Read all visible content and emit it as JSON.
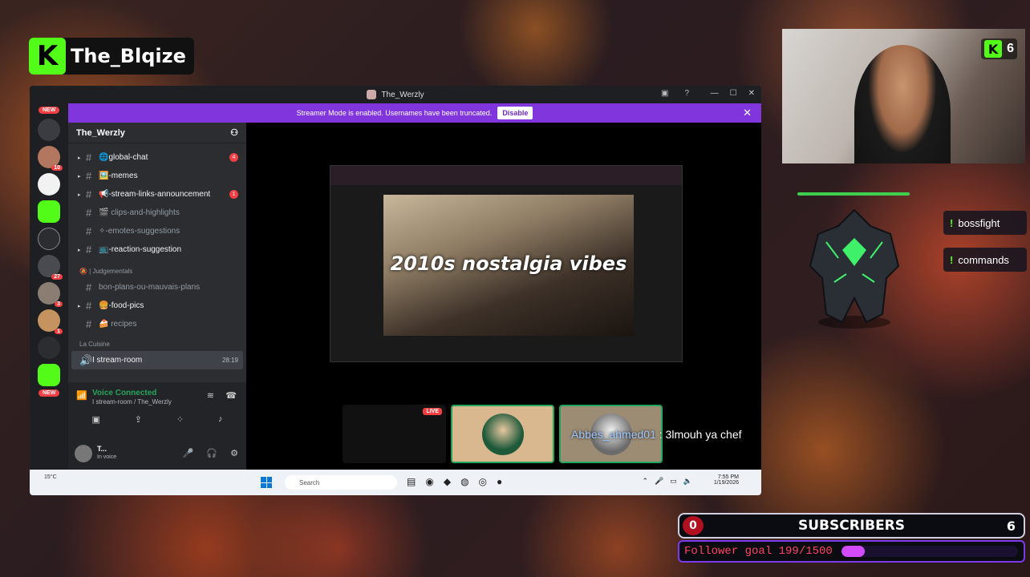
{
  "streamer": {
    "name": "The_Blqize",
    "viewer_count": "6"
  },
  "discord": {
    "window_title": "The_Werzly",
    "banner": {
      "text": "Streamer Mode is enabled. Usernames have been truncated.",
      "button": "Disable"
    },
    "new_label": "NEW",
    "guild_name": "The_Werzly",
    "server_badges": [
      "10",
      "27",
      "3",
      "1"
    ],
    "channels": [
      {
        "label": "🌐global-chat",
        "count": "4",
        "muted": false
      },
      {
        "label": "🖼️-memes",
        "count": "",
        "muted": false
      },
      {
        "label": "📢-stream-links-announcement",
        "count": "1",
        "muted": false
      },
      {
        "label": "🎬 clips-and-highlights",
        "count": "",
        "muted": true
      },
      {
        "label": "✧-emotes-suggestions",
        "count": "",
        "muted": true
      },
      {
        "label": "📺-reaction-suggestion",
        "count": "",
        "muted": false
      }
    ],
    "category_judgementals": "🔕 | Judgementals",
    "channels2": [
      {
        "label": "bon-plans-ou-mauvais-plans",
        "muted": true
      },
      {
        "label": "🍔-food-pics",
        "muted": false
      },
      {
        "label": "🍰 recipes",
        "muted": true
      }
    ],
    "category_cuisine": "La Cuisine",
    "active_voice": {
      "label": "I stream-room",
      "time": "28:19"
    },
    "voice_status": "Voice Connected",
    "voice_room": "I stream-room / The_Werzly",
    "user": {
      "name": "T...",
      "status": "In voice"
    },
    "stream_overlay": "2010s nostalgia vibes",
    "live_label": "LIVE",
    "chat": {
      "user": "Abbes_ahmed01",
      "message": " : 3lmouh ya chef"
    }
  },
  "taskbar": {
    "weather_temp": "15°C",
    "search_placeholder": "Search",
    "time": "7:55 PM",
    "date": "1/19/2026"
  },
  "commands": [
    "bossfight",
    "commands"
  ],
  "subscribers": {
    "label": "SUBSCRIBERS",
    "current": "0",
    "goal": "6"
  },
  "follower_goal": {
    "text": "Follower goal 199/1500",
    "fraction": 0.1327
  },
  "colors": {
    "kick_green": "#53fc18",
    "discord_purple": "#8035dd",
    "goal_fill": "#d24cff"
  }
}
